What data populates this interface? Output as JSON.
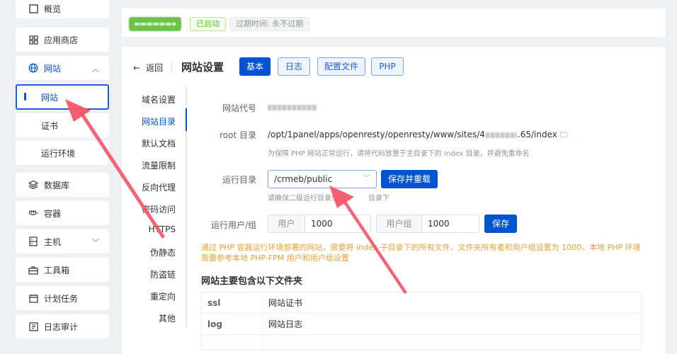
{
  "sidebar": {
    "items": [
      {
        "label": "概览",
        "icon": "overview-icon"
      },
      {
        "label": "应用商店",
        "icon": "app-store-icon"
      },
      {
        "label": "网站",
        "icon": "globe-icon"
      },
      {
        "label": "网站"
      },
      {
        "label": "证书"
      },
      {
        "label": "运行环境"
      },
      {
        "label": "数据库",
        "icon": "database-icon"
      },
      {
        "label": "容器",
        "icon": "container-icon"
      },
      {
        "label": "主机",
        "icon": "host-icon"
      },
      {
        "label": "工具箱",
        "icon": "toolbox-icon"
      },
      {
        "label": "计划任务",
        "icon": "cron-icon"
      },
      {
        "label": "日志审计",
        "icon": "log-audit-icon"
      }
    ]
  },
  "top": {
    "status": "已启动",
    "expire": "过期时间: 永不过期"
  },
  "header": {
    "back": "返回",
    "title": "网站设置",
    "tabs": [
      "基本",
      "日志",
      "配置文件",
      "PHP"
    ]
  },
  "left_nav": [
    "域名设置",
    "网站目录",
    "默认文档",
    "流量限制",
    "反向代理",
    "密码访问",
    "HTTPS",
    "伪静态",
    "防盗链",
    "重定向",
    "其他"
  ],
  "form": {
    "code_label": "网站代号",
    "root_label": "root 目录",
    "root_path_prefix": "/opt/1panel/apps/openresty/openresty/www/sites/4",
    "root_path_suffix": ".65/index",
    "root_hint": "为保障 PHP 网站正常运行，请将代码放置于主目录下的 index 目录，并避免重命名",
    "run_dir_label": "运行目录",
    "run_dir_value": "/crmeb/public",
    "save_reload": "保存并重载",
    "run_dir_hint_a": "请确保二级运行目录位",
    "run_dir_hint_b": "目录下",
    "run_user_label": "运行用户/组",
    "user_prefix": "用户",
    "user_value": "1000",
    "group_prefix": "用户组",
    "group_value": "1000",
    "save": "保存"
  },
  "warning": {
    "line1": "通过 PHP 容器运行环境部署的网站，需要将 index 子目录下的所有文件、文件夹所有者和用户组设置为 1000，本地 PHP 环境",
    "line2": "需要参考本地 PHP-FPM 用户和用户组设置"
  },
  "files": {
    "title": "网站主要包含以下文件夹",
    "rows": [
      {
        "name": "ssl",
        "desc": "网站证书"
      },
      {
        "name": "log",
        "desc": "网站日志"
      }
    ]
  },
  "colors": {
    "primary": "#0054d0",
    "annotation": "#f4566a",
    "warning": "#e6a23c"
  }
}
